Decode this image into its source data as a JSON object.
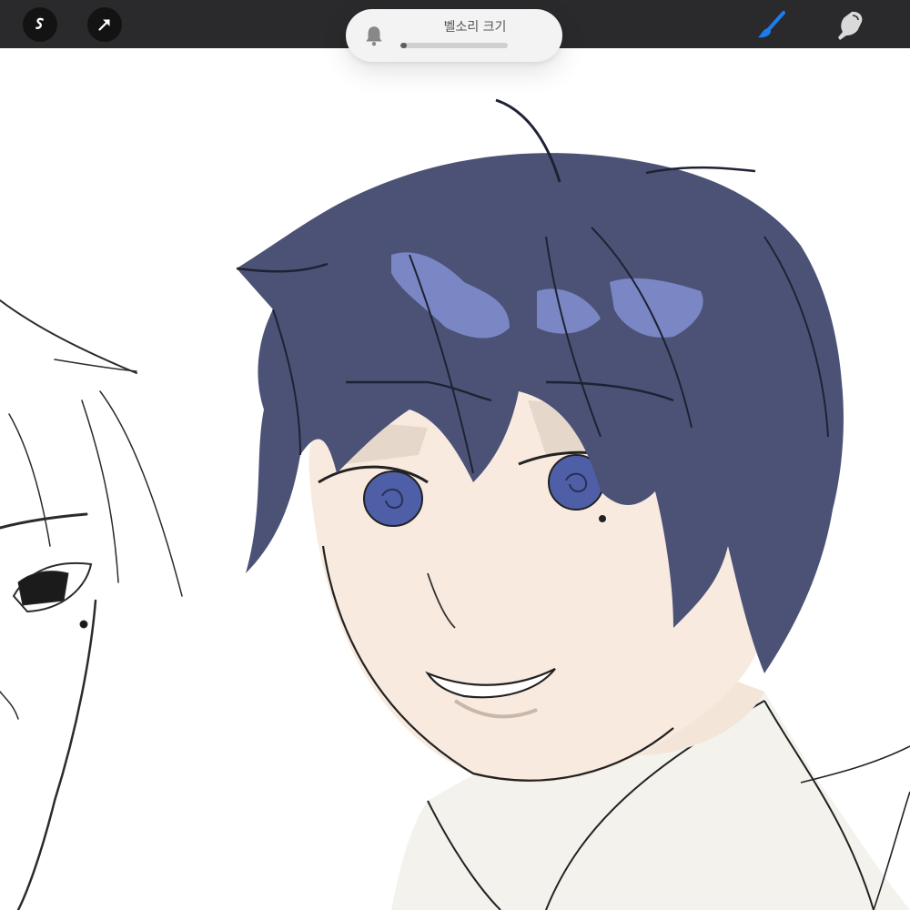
{
  "app": {
    "title": ""
  },
  "toolbar": {
    "left_tools": [
      {
        "name": "adjustments",
        "icon": "adjustments-s-icon"
      },
      {
        "name": "transform",
        "icon": "arrow-cursor-icon"
      }
    ],
    "right_tools": [
      {
        "name": "brush",
        "icon": "brush-icon",
        "active": true,
        "color": "#1d7cf2"
      },
      {
        "name": "smudge",
        "icon": "smudge-finger-icon",
        "active": false,
        "color": "#d9d9d9"
      }
    ]
  },
  "hud": {
    "label": "벨소리 크기",
    "icon": "bell-icon",
    "level": 0.06
  },
  "colors": {
    "topbar": "#2a2a2c",
    "hair": "#4c5276",
    "hair_highlight": "#7a87c4",
    "skin": "#f8eadf",
    "shirt": "#f4f2ec",
    "eye": "#4e5fa8"
  }
}
